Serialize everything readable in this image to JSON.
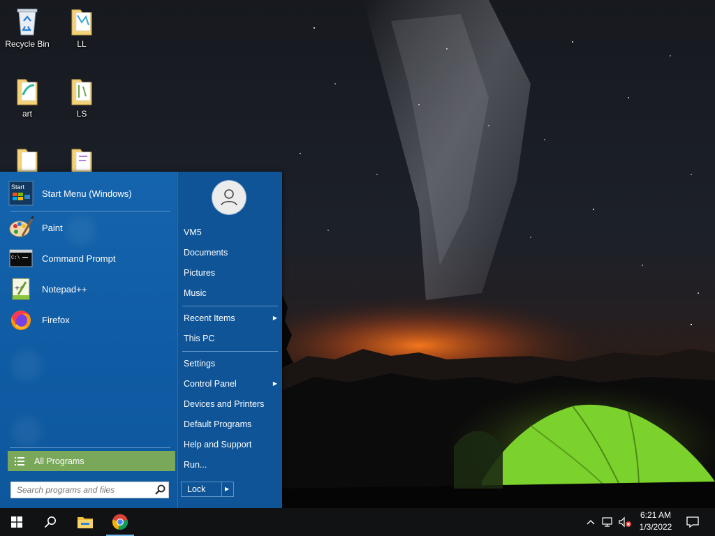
{
  "desktop": {
    "icons": [
      {
        "label": "Recycle Bin",
        "icon": "recycle-bin-icon"
      },
      {
        "label": "LL",
        "icon": "folder-icon"
      },
      {
        "label": "art",
        "icon": "folder-icon"
      },
      {
        "label": "LS",
        "icon": "folder-icon"
      }
    ]
  },
  "start_menu": {
    "pinned_top": {
      "label": "Start Menu (Windows)",
      "icon": "start-menu-app-icon"
    },
    "recent_programs": [
      {
        "label": "Paint",
        "icon": "paint-icon"
      },
      {
        "label": "Command Prompt",
        "icon": "command-prompt-icon"
      },
      {
        "label": "Notepad++",
        "icon": "notepad-plus-plus-icon"
      },
      {
        "label": "Firefox",
        "icon": "firefox-icon"
      }
    ],
    "all_programs_label": "All Programs",
    "search_placeholder": "Search programs and files",
    "right_pane": {
      "user": "VM5",
      "group1": [
        "Documents",
        "Pictures",
        "Music"
      ],
      "recent_items": "Recent Items",
      "this_pc": "This PC",
      "settings": "Settings",
      "control_panel": "Control Panel",
      "devices_and_printers": "Devices and Printers",
      "default_programs": "Default Programs",
      "help_and_support": "Help and Support",
      "run": "Run..."
    },
    "shutdown_button_label": "Lock"
  },
  "taskbar": {
    "pinned": [
      {
        "name": "start-button",
        "icon": "windows-logo-icon"
      },
      {
        "name": "search-button",
        "icon": "search-icon"
      },
      {
        "name": "file-explorer-button",
        "icon": "folder-icon"
      },
      {
        "name": "chrome-button",
        "icon": "chrome-icon",
        "active": true
      }
    ],
    "clock": {
      "time": "6:21 AM",
      "date": "1/3/2022"
    }
  },
  "colors": {
    "menu_blue": "#0f5596",
    "all_programs_green": "#79a85a",
    "taskbar": "#111214"
  }
}
